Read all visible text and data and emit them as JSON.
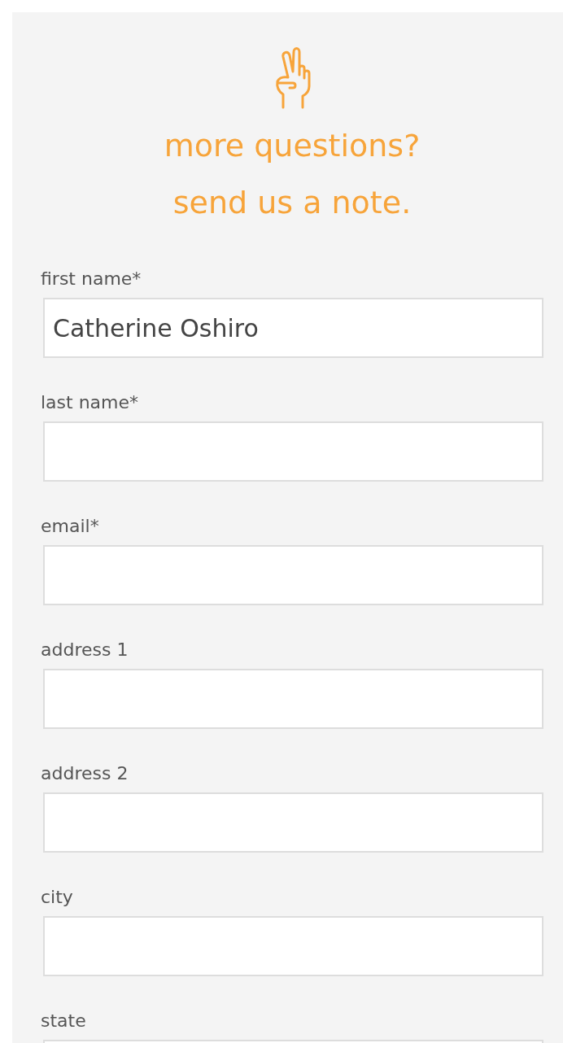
{
  "heading": {
    "lines": [
      "more questions?",
      "send us a note."
    ]
  },
  "fields": [
    {
      "label": "first name*",
      "value": "Catherine Oshiro"
    },
    {
      "label": "last name*"
    },
    {
      "label": "email*"
    },
    {
      "label": "address 1"
    },
    {
      "label": "address 2"
    },
    {
      "label": "city"
    },
    {
      "label": "state"
    }
  ]
}
